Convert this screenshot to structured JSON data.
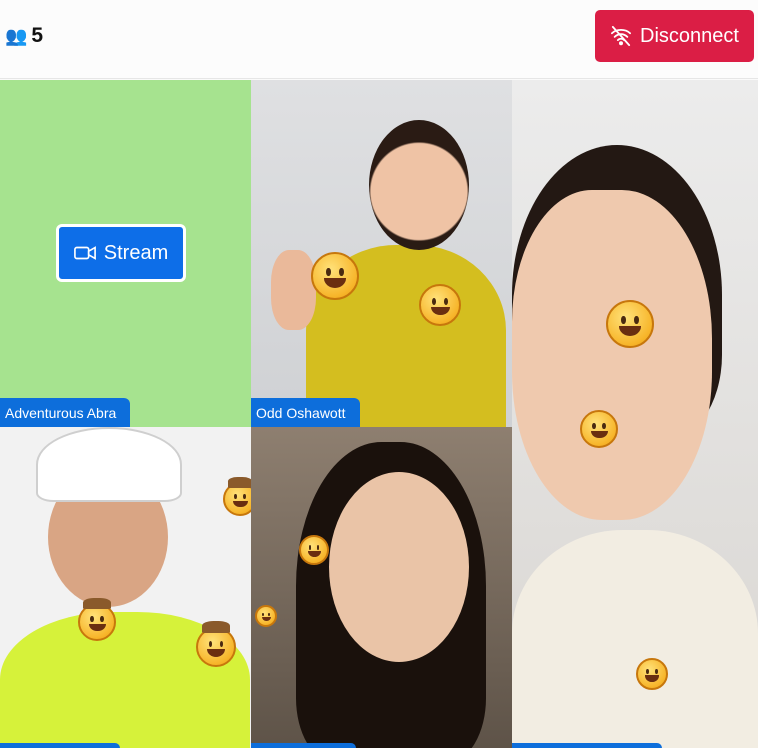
{
  "header": {
    "participant_count": "5",
    "participants_icon": "people-icon",
    "disconnect_label": "Disconnect",
    "disconnect_icon": "wifi-off-icon",
    "disconnect_color": "#db1e45"
  },
  "tiles": [
    {
      "name": "Adventurous Abra",
      "stream_label": "Stream",
      "stream_icon": "video-camera-icon",
      "background": "#a6e38f"
    },
    {
      "name": "Odd Oshawott"
    },
    {
      "name": ""
    },
    {
      "name": ""
    },
    {
      "name": ""
    }
  ],
  "colors": {
    "accent": "#0d6edb"
  }
}
